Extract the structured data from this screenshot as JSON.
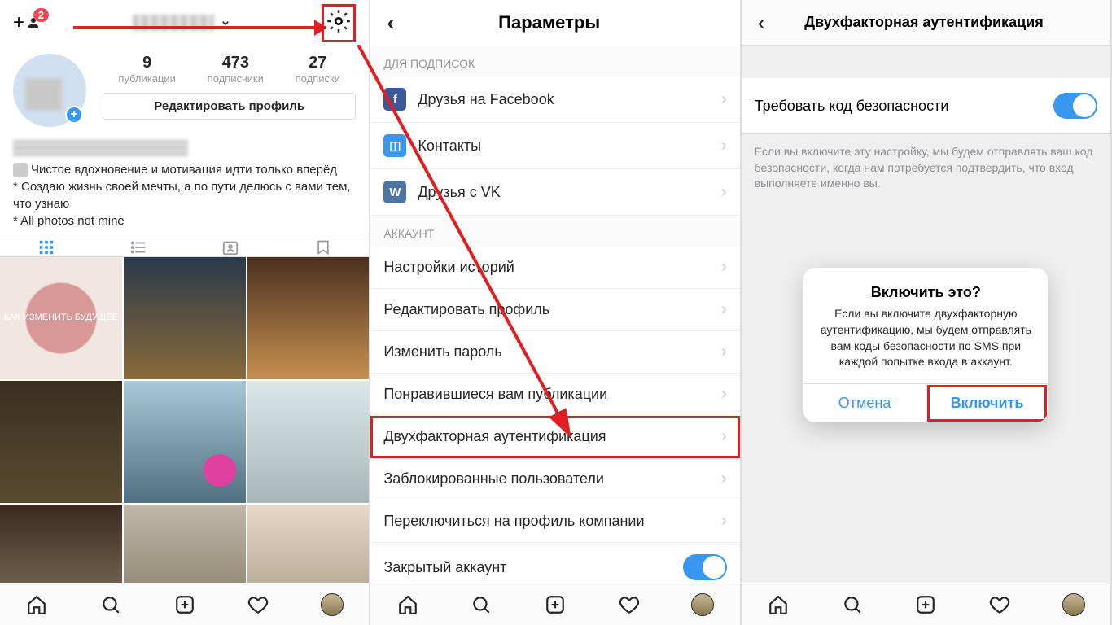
{
  "screen1": {
    "badge_count": "2",
    "stats": {
      "posts_val": "9",
      "posts_lbl": "публикации",
      "followers_val": "473",
      "followers_lbl": "подписчики",
      "following_val": "27",
      "following_lbl": "подписки"
    },
    "edit_profile": "Редактировать профиль",
    "bio_line1": "Чистое вдохновение и мотивация идти только вперёд",
    "bio_line2": "* Создаю жизнь своей мечты, а по пути делюсь с вами тем, что узнаю",
    "bio_line3": "* All photos not mine",
    "grid_labels": {
      "g1": "КАК ИЗМЕНИТЬ БУДУЩЕЕ"
    }
  },
  "screen2": {
    "title": "Параметры",
    "section_subscribe": "ДЛЯ ПОДПИСОК",
    "rows_sub": {
      "fb": "Друзья на Facebook",
      "contacts": "Контакты",
      "vk": "Друзья с VK"
    },
    "section_account": "АККАУНТ",
    "rows_acc": {
      "story_settings": "Настройки историй",
      "edit_profile": "Редактировать профиль",
      "change_pw": "Изменить пароль",
      "liked_posts": "Понравившиеся вам публикации",
      "two_factor": "Двухфакторная аутентификация",
      "blocked": "Заблокированные пользователи",
      "switch_biz": "Переключиться на профиль компании",
      "private": "Закрытый аккаунт"
    }
  },
  "screen3": {
    "title": "Двухфакторная аутентификация",
    "require_code": "Требовать код безопасности",
    "desc": "Если вы включите эту настройку, мы будем отправлять ваш код безопасности, когда нам потребуется подтвердить, что вход выполняете именно вы.",
    "dialog": {
      "title": "Включить это?",
      "msg": "Если вы включите двухфакторную аутентификацию, мы будем отправлять вам коды безопасности по SMS при каждой попытке входа в аккаунт.",
      "cancel": "Отмена",
      "enable": "Включить"
    }
  },
  "colors": {
    "highlight": "#e02020",
    "accent": "#3897f0"
  }
}
